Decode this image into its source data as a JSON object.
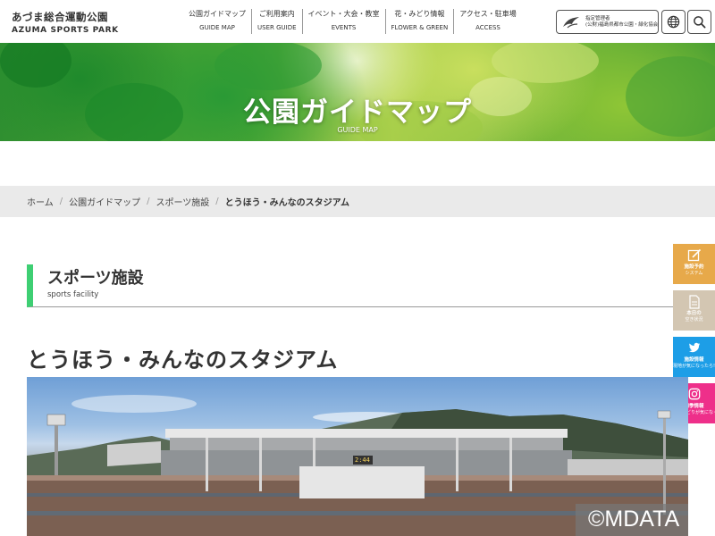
{
  "header": {
    "logo_jp": "あづま総合運動公園",
    "logo_en": "AZUMA SPORTS PARK",
    "nav": [
      {
        "jp": "公園ガイドマップ",
        "en": "GUIDE MAP"
      },
      {
        "jp": "ご利用案内",
        "en": "USER GUIDE"
      },
      {
        "jp": "イベント・大会・教室",
        "en": "EVENTS"
      },
      {
        "jp": "花・みどり情報",
        "en": "FLOWER & GREEN"
      },
      {
        "jp": "アクセス・駐車場",
        "en": "ACCESS"
      }
    ],
    "manager_line1": "指定管理者",
    "manager_line2": "(公財)福島県都市公園・緑化協会"
  },
  "hero": {
    "title": "公園ガイドマップ",
    "subtitle": "GUIDE MAP"
  },
  "breadcrumb": {
    "items": [
      "ホーム",
      "公園ガイドマップ",
      "スポーツ施設"
    ],
    "separator": "/",
    "current": "とうほう・みんなのスタジアム"
  },
  "section": {
    "title": "スポーツ施設",
    "subtitle": "sports facility"
  },
  "side_buttons": [
    {
      "line1": "施設予約",
      "line2": "システム",
      "icon": "edit-icon",
      "color": "#e7a94a"
    },
    {
      "line1": "本日の",
      "line2": "空き状況",
      "icon": "document-icon",
      "color": "#d3c6b2"
    },
    {
      "line1": "施設情報",
      "line2": "現地が気になったら!",
      "icon": "twitter-icon",
      "color": "#1d9ee7"
    },
    {
      "line1": "四季情報",
      "line2": "花・みどりが気になったら!",
      "icon": "instagram-icon",
      "color": "#ee2f8a"
    }
  ],
  "page": {
    "title": "とうほう・みんなのスタジアム"
  },
  "photo": {
    "scoreboard_clock": "2:44",
    "watermark": "©MDATA"
  },
  "colors": {
    "section_accent": "#3ecf73",
    "breadcrumb_bg": "#eaeaea"
  }
}
